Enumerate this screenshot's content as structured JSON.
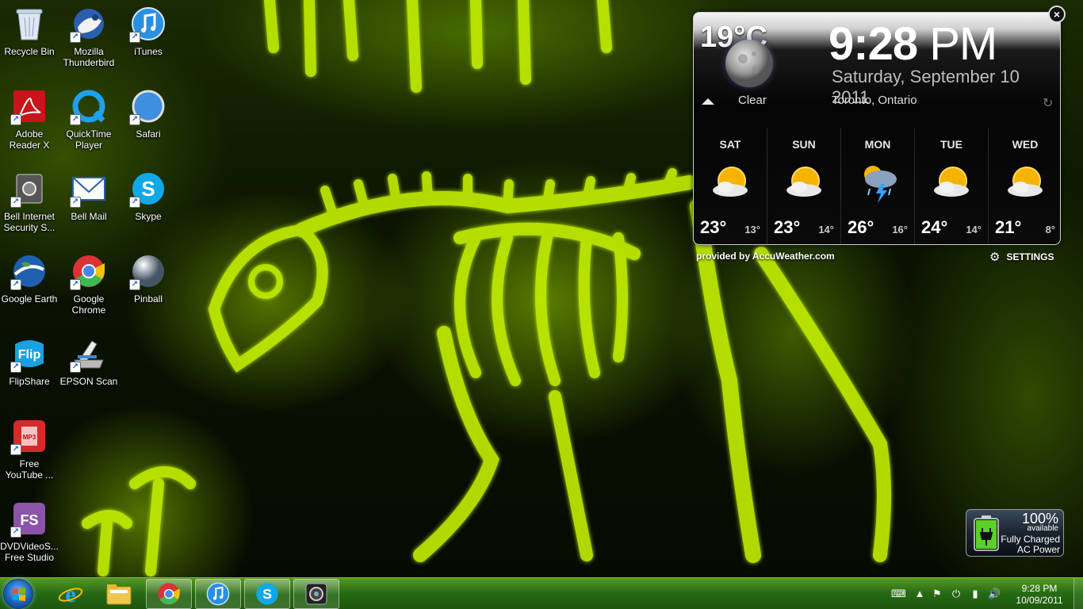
{
  "desktop": {
    "icons": [
      {
        "label": "Recycle Bin",
        "icon": "recycle-bin-icon"
      },
      {
        "label": "Mozilla Thunderbird",
        "icon": "thunderbird-icon"
      },
      {
        "label": "iTunes",
        "icon": "itunes-icon"
      },
      {
        "label": "Adobe Reader X",
        "icon": "adobe-reader-icon"
      },
      {
        "label": "QuickTime Player",
        "icon": "quicktime-icon"
      },
      {
        "label": "Safari",
        "icon": "safari-icon"
      },
      {
        "label": "Bell Internet Security S...",
        "icon": "bell-security-icon"
      },
      {
        "label": "Bell Mail",
        "icon": "bell-mail-icon"
      },
      {
        "label": "Skype",
        "icon": "skype-icon"
      },
      {
        "label": "Google Earth",
        "icon": "google-earth-icon"
      },
      {
        "label": "Google Chrome",
        "icon": "chrome-icon"
      },
      {
        "label": "Pinball",
        "icon": "pinball-icon"
      },
      {
        "label": "FlipShare",
        "icon": "flipshare-icon"
      },
      {
        "label": "EPSON Scan",
        "icon": "epson-scan-icon"
      },
      {
        "label": "Free YouTube ...",
        "icon": "free-youtube-icon"
      },
      {
        "label": "DVDVideoS... Free Studio",
        "icon": "dvdvideosoft-icon"
      }
    ]
  },
  "weather": {
    "current_temp": "19°C",
    "condition": "Clear",
    "time_main": "9:28",
    "time_ampm": "PM",
    "date": "Saturday, September 10 2011",
    "location": "Toronto, Ontario",
    "provider": "provided by AccuWeather.com",
    "settings_label": "SETTINGS",
    "forecast": [
      {
        "day": "SAT",
        "hi": "23°",
        "lo": "13°",
        "icon": "partly-sunny-icon"
      },
      {
        "day": "SUN",
        "hi": "23°",
        "lo": "14°",
        "icon": "partly-sunny-icon"
      },
      {
        "day": "MON",
        "hi": "26°",
        "lo": "16°",
        "icon": "thunderstorm-icon"
      },
      {
        "day": "TUE",
        "hi": "24°",
        "lo": "14°",
        "icon": "partly-sunny-icon"
      },
      {
        "day": "WED",
        "hi": "21°",
        "lo": "8°",
        "icon": "partly-sunny-icon"
      }
    ]
  },
  "battery": {
    "percent": "100%",
    "available": "available",
    "status_line1": "Fully Charged",
    "status_line2": "AC Power",
    "level": 1.0
  },
  "taskbar": {
    "pinned": [
      {
        "name": "internet-explorer",
        "icon": "ie-icon",
        "active": false
      },
      {
        "name": "windows-explorer",
        "icon": "folder-icon",
        "active": false
      },
      {
        "name": "google-chrome",
        "icon": "chrome-icon",
        "active": true
      },
      {
        "name": "itunes",
        "icon": "itunes-icon",
        "active": true
      },
      {
        "name": "skype",
        "icon": "skype-icon",
        "active": true
      },
      {
        "name": "webcam",
        "icon": "webcam-icon",
        "active": true
      }
    ],
    "clock_time": "9:28 PM",
    "clock_date": "10/09/2011"
  },
  "colors": {
    "accent_green": "#a8e000",
    "taskbar_green": "#2f7a18"
  }
}
